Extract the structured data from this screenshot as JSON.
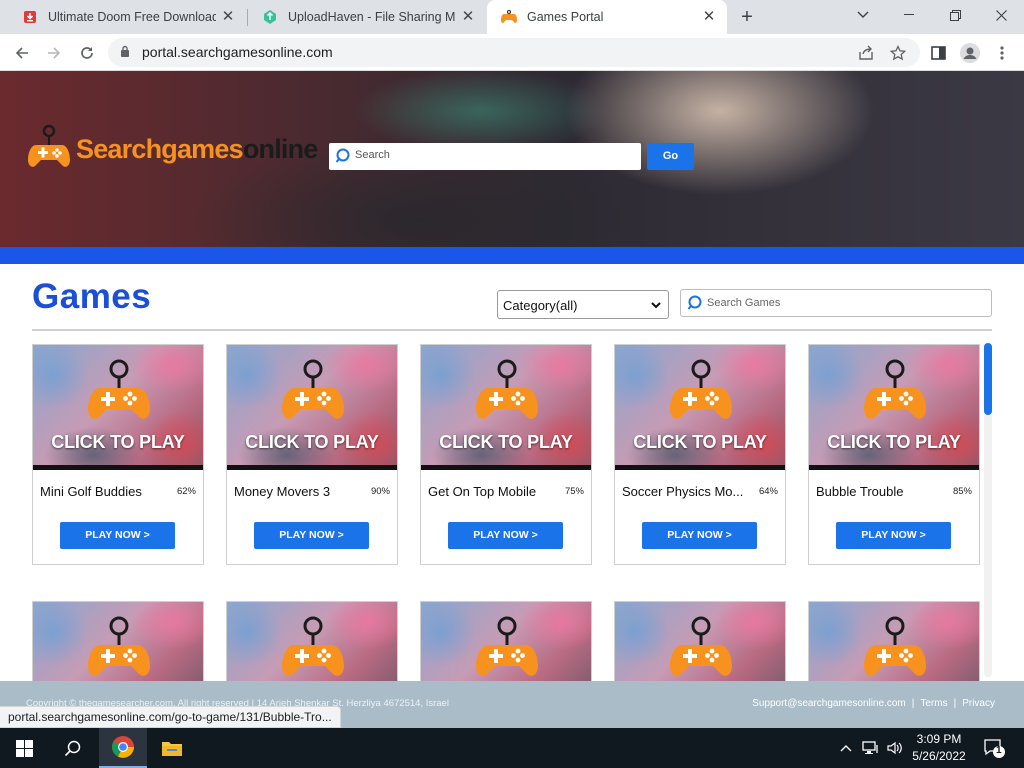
{
  "browser": {
    "tabs": [
      {
        "title": "Ultimate Doom Free Download (",
        "active": false,
        "icon": "red-download-icon"
      },
      {
        "title": "UploadHaven - File Sharing Made",
        "active": false,
        "icon": "uploadhaven-icon"
      },
      {
        "title": "Games Portal",
        "active": true,
        "icon": "game-controller-icon"
      }
    ],
    "new_tab_label": "+",
    "url": "portal.searchgamesonline.com"
  },
  "site": {
    "logo": {
      "part1": "Searchgames",
      "part2": "online"
    },
    "hero_search_placeholder": "Search",
    "go_label": "Go",
    "section_title": "Games",
    "category_value": "Category(all)",
    "games_search_placeholder": "Search Games",
    "play_overlay": "CLICK TO PLAY",
    "play_button_label": "PLAY NOW >",
    "games": [
      {
        "name": "Mini Golf Buddies",
        "rating": "62%"
      },
      {
        "name": "Money Movers 3",
        "rating": "90%"
      },
      {
        "name": "Get On Top Mobile",
        "rating": "75%"
      },
      {
        "name": "Soccer Physics Mo...",
        "rating": "64%"
      },
      {
        "name": "Bubble Trouble",
        "rating": "85%"
      }
    ],
    "footer": {
      "copyright": "Copyright © thegamesearcher.com. All right reserved | 14 Arieh Shenkar St. Herzliya 4672514, Israel",
      "support": "Support@searchgamesonline.com",
      "sep": "|",
      "terms": "Terms",
      "privacy": "Privacy"
    }
  },
  "status_url": "portal.searchgamesonline.com/go-to-game/131/Bubble-Tro...",
  "taskbar": {
    "time": "3:09 PM",
    "date": "5/26/2022",
    "notification_count": "1"
  },
  "colors": {
    "accent_blue": "#1a73e8",
    "title_blue": "#1b4fd6",
    "logo_orange": "#f7921e",
    "band_blue": "#1a56e8"
  }
}
